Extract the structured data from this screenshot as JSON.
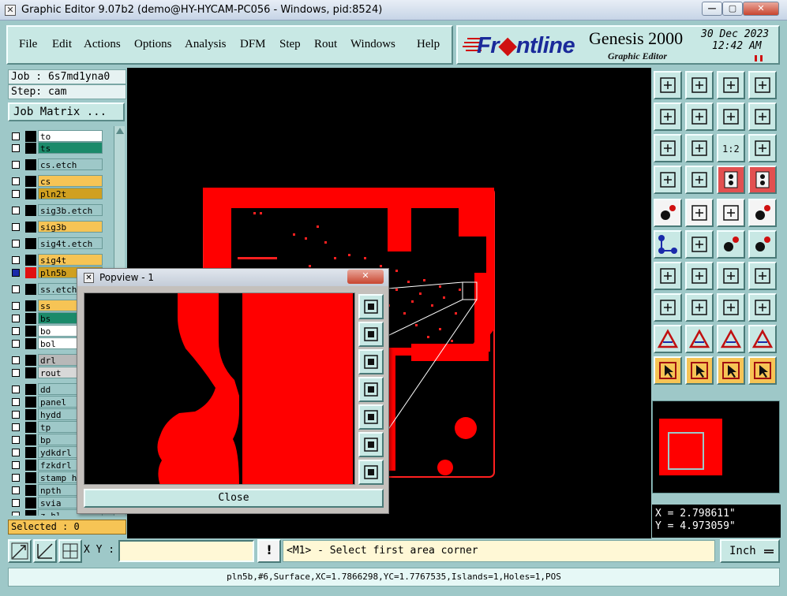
{
  "window": {
    "title": "Graphic Editor 9.07b2 (demo@HY-HYCAM-PC056 - Windows, pid:8524)",
    "min_label": "—",
    "max_label": "▢",
    "close_label": "✕"
  },
  "menu": {
    "items": [
      "File",
      "Edit",
      "Actions",
      "Options",
      "Analysis",
      "DFM",
      "Step",
      "Rout",
      "Windows",
      "Help"
    ]
  },
  "brand": {
    "name_a": "Fr",
    "name_b": "ntline",
    "product": "Genesis 2000",
    "subtitle": "Graphic Editor",
    "date": "30 Dec 2023",
    "time": "12:42 AM"
  },
  "job": {
    "job_label": "Job : 6s7md1yna0",
    "step_label": "Step: cam",
    "matrix_button": "Job Matrix ..."
  },
  "layers": [
    {
      "name": "to",
      "color": "#ffffff",
      "swatch": "#000000",
      "selected": false
    },
    {
      "name": "ts",
      "color": "#1a8a6a",
      "swatch": "#000000",
      "selected": false
    },
    {
      "name": "cs.etch",
      "color": "#9ec8c8",
      "swatch": "#000000",
      "selected": false
    },
    {
      "name": "cs",
      "color": "#f6c455",
      "swatch": "#000000",
      "selected": false
    },
    {
      "name": "pln2t",
      "color": "#d0a020",
      "swatch": "#000000",
      "selected": false
    },
    {
      "name": "sig3b.etch",
      "color": "#9ec8c8",
      "swatch": "#000000",
      "selected": false
    },
    {
      "name": "sig3b",
      "color": "#f6c455",
      "swatch": "#000000",
      "selected": false
    },
    {
      "name": "sig4t.etch",
      "color": "#9ec8c8",
      "swatch": "#000000",
      "selected": false
    },
    {
      "name": "sig4t",
      "color": "#f6c455",
      "swatch": "#000000",
      "selected": false
    },
    {
      "name": "pln5b",
      "color": "#d0a020",
      "swatch": "#e01010",
      "selected": true
    },
    {
      "name": "ss.etch",
      "color": "#9ec8c8",
      "swatch": "#000000",
      "selected": false
    },
    {
      "name": "ss",
      "color": "#f6c455",
      "swatch": "#000000",
      "selected": false
    },
    {
      "name": "bs",
      "color": "#1a8a6a",
      "swatch": "#000000",
      "selected": false
    },
    {
      "name": "bo",
      "color": "#ffffff",
      "swatch": "#000000",
      "selected": false
    },
    {
      "name": "bol",
      "color": "#ffffff",
      "swatch": "#000000",
      "selected": false
    },
    {
      "name": "drl",
      "color": "#b8b8b8",
      "swatch": "#000000",
      "selected": false
    },
    {
      "name": "rout",
      "color": "#d8d8d8",
      "swatch": "#000000",
      "selected": false
    },
    {
      "name": "dd",
      "color": "#9ec8c8",
      "swatch": "#000000",
      "selected": false
    },
    {
      "name": "panel",
      "color": "#9ec8c8",
      "swatch": "#000000",
      "selected": false
    },
    {
      "name": "hydd",
      "color": "#9ec8c8",
      "swatch": "#000000",
      "selected": false
    },
    {
      "name": "tp",
      "color": "#9ec8c8",
      "swatch": "#000000",
      "selected": false
    },
    {
      "name": "bp",
      "color": "#9ec8c8",
      "swatch": "#000000",
      "selected": false
    },
    {
      "name": "ydkdrl",
      "color": "#9ec8c8",
      "swatch": "#000000",
      "selected": false
    },
    {
      "name": "fzkdrl",
      "color": "#9ec8c8",
      "swatch": "#000000",
      "selected": false
    },
    {
      "name": "stamp_h",
      "color": "#9ec8c8",
      "swatch": "#000000",
      "selected": false
    },
    {
      "name": "npth",
      "color": "#9ec8c8",
      "swatch": "#000000",
      "selected": false
    },
    {
      "name": "svia",
      "color": "#9ec8c8",
      "swatch": "#000000",
      "selected": false
    },
    {
      "name": "z.hl...",
      "color": "#9ec8c8",
      "swatch": "#000000",
      "selected": false
    }
  ],
  "selected_label": "Selected : 0",
  "coords": {
    "x": "X = 2.798611\"",
    "y": "Y = 4.973059\""
  },
  "bottom": {
    "xy_label": "X Y :",
    "xy_value": "",
    "warn_label": "!",
    "prompt": "<M1> - Select first area corner",
    "unit": "Inch"
  },
  "status": "pln5b,#6,Surface,XC=1.7866298,YC=1.7767535,Islands=1,Holes=1,POS",
  "popview": {
    "title": "Popview - 1",
    "close_label": "Close",
    "close_x": "✕"
  },
  "toolbox": {
    "scale_label": "1:2"
  }
}
